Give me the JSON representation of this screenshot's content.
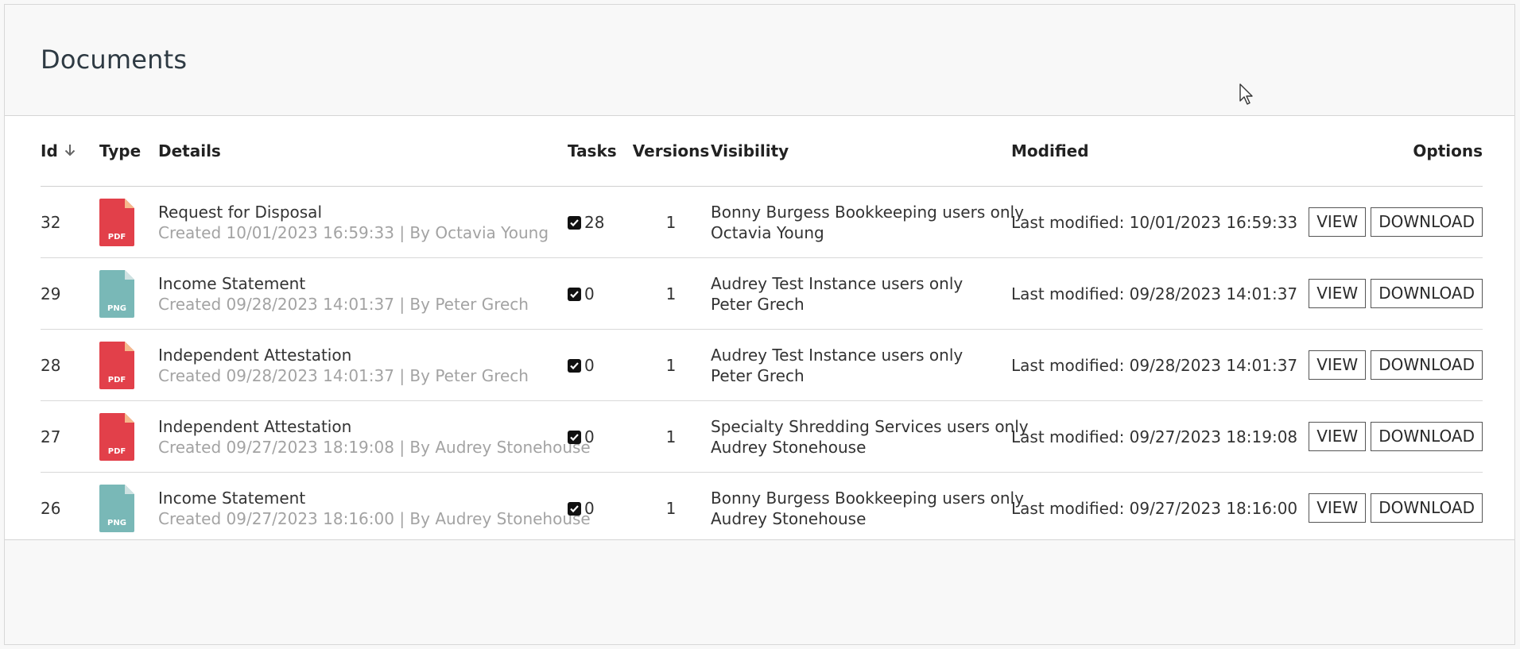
{
  "page": {
    "title": "Documents"
  },
  "table": {
    "headers": {
      "id": "Id",
      "type": "Type",
      "details": "Details",
      "tasks": "Tasks",
      "versions": "Versions",
      "visibility": "Visibility",
      "modified": "Modified",
      "options": "Options"
    },
    "sort": {
      "column": "Id",
      "direction": "descending",
      "icon": "arrow-down-icon"
    },
    "rows": [
      {
        "id": "32",
        "type": "PDF",
        "title": "Request for Disposal",
        "created": "Created 10/01/2023 16:59:33 | By Octavia Young",
        "tasks": "28",
        "versions": "1",
        "visibility": "Bonny Burgess Bookkeeping users only",
        "owner": "Octavia Young",
        "modified": "Last modified: 10/01/2023 16:59:33"
      },
      {
        "id": "29",
        "type": "PNG",
        "title": "Income Statement",
        "created": "Created 09/28/2023 14:01:37 | By Peter Grech",
        "tasks": "0",
        "versions": "1",
        "visibility": "Audrey Test Instance users only",
        "owner": "Peter Grech",
        "modified": "Last modified: 09/28/2023 14:01:37"
      },
      {
        "id": "28",
        "type": "PDF",
        "title": "Independent Attestation",
        "created": "Created 09/28/2023 14:01:37 | By Peter Grech",
        "tasks": "0",
        "versions": "1",
        "visibility": "Audrey Test Instance users only",
        "owner": "Peter Grech",
        "modified": "Last modified: 09/28/2023 14:01:37"
      },
      {
        "id": "27",
        "type": "PDF",
        "title": "Independent Attestation",
        "created": "Created 09/27/2023 18:19:08 | By Audrey Stonehouse",
        "tasks": "0",
        "versions": "1",
        "visibility": "Specialty Shredding Services users only",
        "owner": "Audrey Stonehouse",
        "modified": "Last modified: 09/27/2023 18:19:08"
      },
      {
        "id": "26",
        "type": "PNG",
        "title": "Income Statement",
        "created": "Created 09/27/2023 18:16:00 | By Audrey Stonehouse",
        "tasks": "0",
        "versions": "1",
        "visibility": "Bonny Burgess Bookkeeping users only",
        "owner": "Audrey Stonehouse",
        "modified": "Last modified: 09/27/2023 18:16:00"
      }
    ]
  },
  "buttons": {
    "view": "VIEW",
    "download": "DOWNLOAD"
  },
  "colors": {
    "pdf": "#e2404a",
    "pdf_fold": "#f5b98c",
    "png": "#79b8b7",
    "png_fold": "#cfe2e2"
  }
}
